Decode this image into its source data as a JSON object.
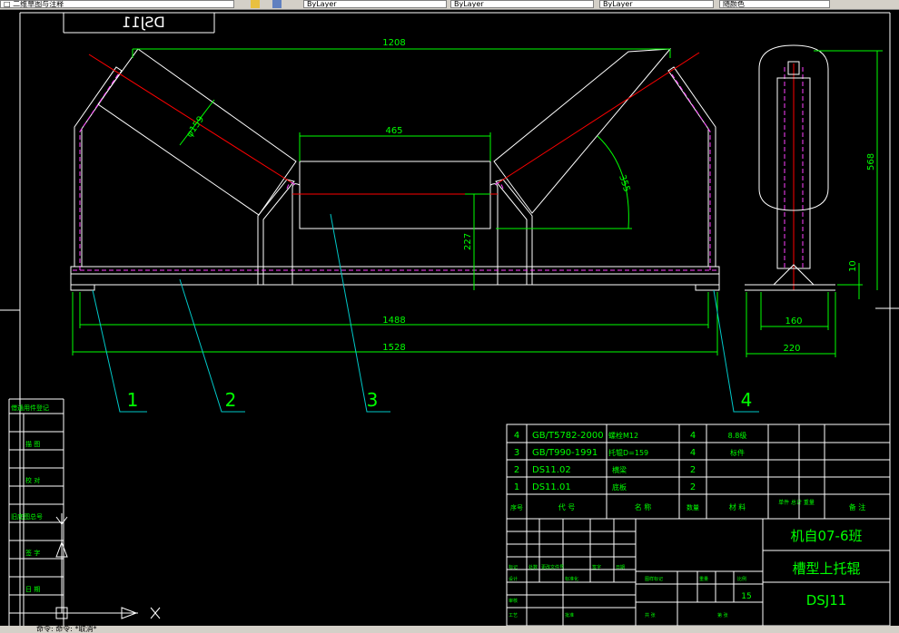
{
  "toolbar": {
    "field1": "□ 二维草图与注释",
    "field2": "ByLayer",
    "field3": "ByLayer",
    "field4": "ByLayer",
    "field5": "随颜色"
  },
  "drawing": {
    "mirrored_title": "DSJ11",
    "dims": {
      "d1208": "1208",
      "d465": "465",
      "dia": "φ159",
      "d355": "355",
      "d227": "227",
      "d1488": "1488",
      "d1528": "1528",
      "d568": "568",
      "d10": "10",
      "d160": "160",
      "d220": "220"
    },
    "balloons": [
      "1",
      "2",
      "3",
      "4"
    ]
  },
  "side_labels": [
    "借通用件登记",
    "描 图",
    "校 对",
    "旧底图总号",
    "签 字",
    "日 期"
  ],
  "parts_list": {
    "rows": [
      {
        "no": "4",
        "code": "GB/T5782-2000",
        "name": "螺栓M12",
        "qty": "4",
        "material": "8.8级",
        "note": ""
      },
      {
        "no": "3",
        "code": "GB/T990-1991",
        "name": "托辊D=159",
        "qty": "4",
        "material": "标件",
        "note": ""
      },
      {
        "no": "2",
        "code": "DS11.02",
        "name": "横梁",
        "qty": "2",
        "material": "",
        "note": ""
      },
      {
        "no": "1",
        "code": "DS11.01",
        "name": "底板",
        "qty": "2",
        "material": "",
        "note": ""
      }
    ],
    "header": {
      "no": "序号",
      "code": "代 号",
      "name": "名 称",
      "qty": "数量",
      "material": "材 料",
      "weight": "单件 总计 重量",
      "note": "备 注"
    }
  },
  "title_block": {
    "school": "机自07-6班",
    "drawing_name": "槽型上托辊",
    "drawing_no": "DSJ11",
    "scale_value": "15",
    "small_labels": [
      "标记",
      "处数",
      "更改文件号",
      "签字",
      "日期",
      "设计",
      "标准化",
      "审核",
      "工艺",
      "批准",
      "图样标记",
      "重量",
      "比例",
      "共 张",
      "第 张"
    ]
  },
  "colors": {
    "line_white": "#ffffff",
    "line_green": "#00ff00",
    "line_cyan": "#00c8c8",
    "line_red": "#ff0000",
    "line_magenta": "#ff40ff",
    "text_green": "#00ff00",
    "text_yellow": "#ffff00"
  },
  "statusbar": {
    "text": "命令:  命令:  *取消*"
  }
}
